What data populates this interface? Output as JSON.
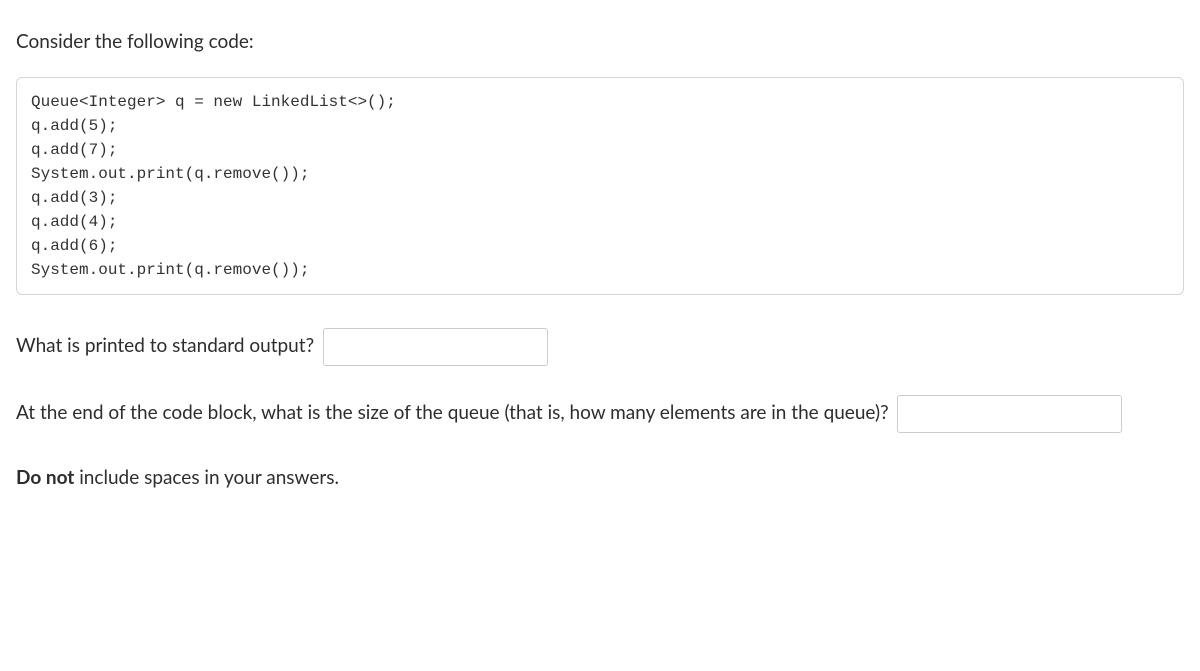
{
  "intro": "Consider the following code:",
  "code": "Queue<Integer> q = new LinkedList<>();\nq.add(5);\nq.add(7);\nSystem.out.print(q.remove());\nq.add(3);\nq.add(4);\nq.add(6);\nSystem.out.print(q.remove());",
  "q1": {
    "text": "What is printed to standard output?",
    "value": ""
  },
  "q2": {
    "text_before": "At the end of the code block, what is the size of the queue (that is, how many elements are in the queue)?",
    "value": ""
  },
  "note_prefix": "Do not",
  "note_rest": " include spaces in your answers."
}
